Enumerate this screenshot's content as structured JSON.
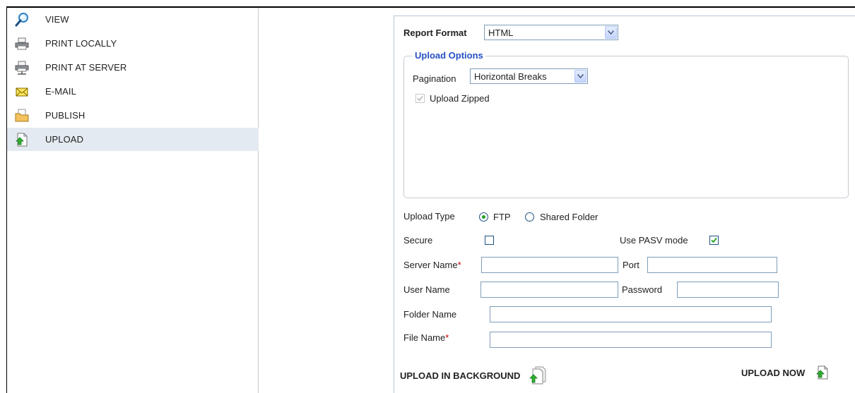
{
  "sidebar": {
    "items": [
      {
        "label": "VIEW",
        "icon": "magnifier-icon"
      },
      {
        "label": "PRINT LOCALLY",
        "icon": "printer-icon"
      },
      {
        "label": "PRINT AT SERVER",
        "icon": "server-printer-icon"
      },
      {
        "label": "E-MAIL",
        "icon": "envelope-icon"
      },
      {
        "label": "PUBLISH",
        "icon": "folder-icon"
      },
      {
        "label": "UPLOAD",
        "icon": "upload-icon"
      }
    ],
    "active": "UPLOAD"
  },
  "form": {
    "report_format_label": "Report Format",
    "report_format_value": "HTML",
    "upload_options_legend": "Upload Options",
    "pagination_label": "Pagination",
    "pagination_value": "Horizontal Breaks",
    "upload_zipped_label": "Upload Zipped",
    "upload_zipped_checked": true,
    "upload_type_label": "Upload Type",
    "upload_type_options": [
      "FTP",
      "Shared Folder"
    ],
    "upload_type_selected": "FTP",
    "secure_label": "Secure",
    "secure_checked": false,
    "pasv_label": "Use PASV mode",
    "pasv_checked": true,
    "server_name_label": "Server Name",
    "port_label": "Port",
    "user_name_label": "User Name",
    "password_label": "Password",
    "folder_name_label": "Folder Name",
    "file_name_label": "File Name",
    "required_marker": "*",
    "server_name_value": "",
    "port_value": "",
    "user_name_value": "",
    "password_value": "",
    "folder_name_value": "",
    "file_name_value": ""
  },
  "actions": {
    "upload_background_label": "UPLOAD IN BACKGROUND",
    "upload_now_label": "UPLOAD NOW"
  },
  "colors": {
    "legend": "#2550c4",
    "active_row": "#e3eaf1",
    "required": "#c00000",
    "check_green": "#21a121"
  }
}
